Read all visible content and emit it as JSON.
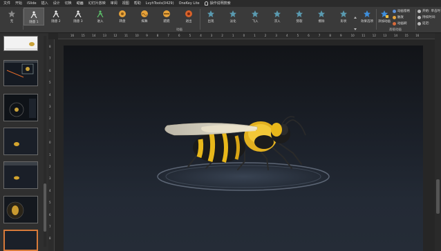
{
  "menubar": {
    "items": [
      "文件",
      "开始",
      "iSlide",
      "插入",
      "设计",
      "切换",
      "动画",
      "幻灯片放映",
      "审阅",
      "视图",
      "帮助",
      "LvyhTools(0429)",
      "OneKey Lite"
    ],
    "search_label": "操作说明搜索"
  },
  "ribbon": {
    "animations": [
      {
        "label": "无",
        "icon": "none-star-icon"
      },
      {
        "label": "随意 1",
        "icon": "random-path-icon"
      },
      {
        "label": "随意 2",
        "icon": "random-path-icon"
      },
      {
        "label": "随意 3",
        "icon": "random-path-icon"
      },
      {
        "label": "进入",
        "icon": "enter-runner-icon"
      },
      {
        "label": "转盘",
        "icon": "wheel-icon"
      },
      {
        "label": "挥舞",
        "icon": "wave-icon"
      },
      {
        "label": "跷跷",
        "icon": "seesaw-icon"
      },
      {
        "label": "退出",
        "icon": "exit-icon"
      },
      {
        "label": "出现",
        "icon": "appear-star-icon"
      },
      {
        "label": "淡化",
        "icon": "fade-star-icon"
      },
      {
        "label": "飞入",
        "icon": "fly-in-star-icon"
      },
      {
        "label": "浮入",
        "icon": "float-in-star-icon"
      },
      {
        "label": "劈裂",
        "icon": "split-star-icon"
      },
      {
        "label": "擦除",
        "icon": "wipe-star-icon"
      },
      {
        "label": "形状",
        "icon": "shape-star-icon"
      }
    ],
    "group_animation_label": "动画",
    "effect_options_label": "效果选项",
    "add_animation_label": "添加动画",
    "group_advanced_label": "高级动画",
    "animation_pane_label": "动画窗格",
    "trigger_label": "触发",
    "painter_label": "动画刷",
    "start_label": "开始:",
    "duration_label": "持续时间:",
    "delay_label": "延迟:",
    "start_value": "单击时"
  },
  "thumbnails": [
    {
      "num": "",
      "style": "white"
    },
    {
      "num": "",
      "style": "dark"
    },
    {
      "num": "",
      "style": "dark"
    },
    {
      "num": "",
      "style": "white"
    },
    {
      "num": "",
      "style": "dark"
    },
    {
      "num": "",
      "style": "dark"
    },
    {
      "num": "",
      "style": "selected"
    }
  ],
  "ruler": {
    "h_ticks": [
      "16",
      "15",
      "14",
      "13",
      "12",
      "11",
      "10",
      "9",
      "8",
      "7",
      "6",
      "5",
      "4",
      "3",
      "2",
      "1",
      "0",
      "1",
      "2",
      "3",
      "4",
      "5",
      "6",
      "7",
      "8",
      "9",
      "10",
      "11",
      "12",
      "13",
      "14",
      "15",
      "16"
    ],
    "v_ticks": [
      "8",
      "7",
      "6",
      "5",
      "4",
      "3",
      "2",
      "1",
      "0",
      "1",
      "2",
      "3",
      "4",
      "5",
      "6",
      "7",
      "8"
    ]
  },
  "colors": {
    "accent_selected": "#d87a3a",
    "ribbon_bg": "#3a3a3a",
    "slide_bg": "#1b2029"
  }
}
